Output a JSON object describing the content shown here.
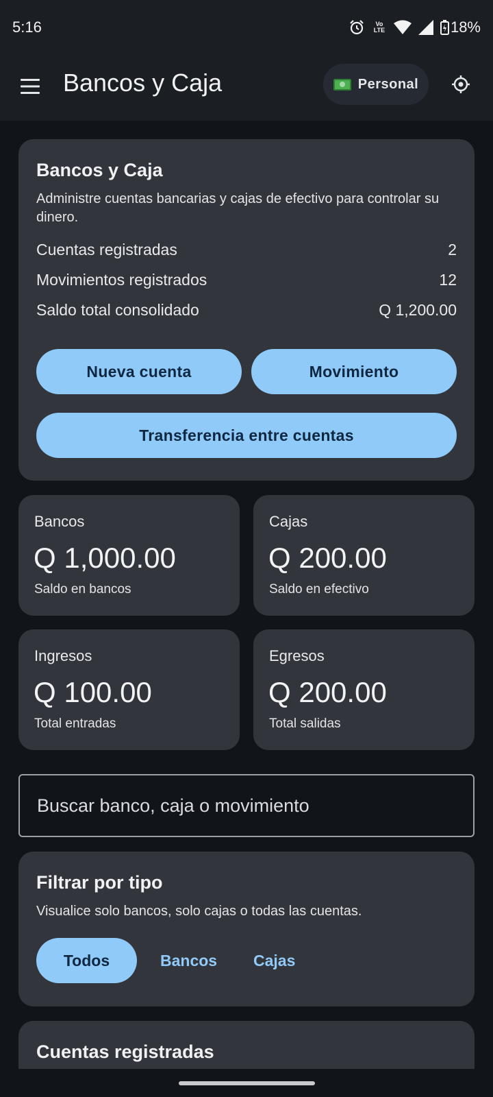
{
  "status_bar": {
    "time": "5:16",
    "battery": "18%",
    "network_label": "Vo LTE",
    "icons": [
      "alarm-icon",
      "volte-icon",
      "wifi-icon",
      "signal-icon",
      "battery-icon"
    ]
  },
  "app_bar": {
    "title": "Bancos y Caja",
    "profile_label": "Personal",
    "icons": [
      "menu-icon",
      "money-icon",
      "theme-icon"
    ]
  },
  "summary": {
    "title": "Bancos y Caja",
    "description": "Administre cuentas bancarias y cajas de efectivo para controlar su dinero.",
    "stats": [
      {
        "label": "Cuentas registradas",
        "value": "2"
      },
      {
        "label": "Movimientos registrados",
        "value": "12"
      },
      {
        "label": "Saldo total consolidado",
        "value": "Q 1,200.00"
      }
    ],
    "buttons": {
      "new_account": "Nueva cuenta",
      "movement": "Movimiento",
      "transfer": "Transferencia entre cuentas"
    }
  },
  "metrics": [
    {
      "label": "Bancos",
      "value": "Q 1,000.00",
      "sub": "Saldo en bancos"
    },
    {
      "label": "Cajas",
      "value": "Q 200.00",
      "sub": "Saldo en efectivo"
    },
    {
      "label": "Ingresos",
      "value": "Q 100.00",
      "sub": "Total entradas"
    },
    {
      "label": "Egresos",
      "value": "Q 200.00",
      "sub": "Total salidas"
    }
  ],
  "search": {
    "placeholder": "Buscar banco, caja o movimiento"
  },
  "filter": {
    "title": "Filtrar por tipo",
    "description": "Visualice solo bancos, solo cajas o todas las cuentas.",
    "options": [
      "Todos",
      "Bancos",
      "Cajas"
    ],
    "selected": "Todos"
  },
  "accounts": {
    "title": "Cuentas registradas"
  },
  "colors": {
    "background": "#111418",
    "card": "#33353c",
    "accent": "#90caf9",
    "app_bar": "#1b1f24"
  }
}
